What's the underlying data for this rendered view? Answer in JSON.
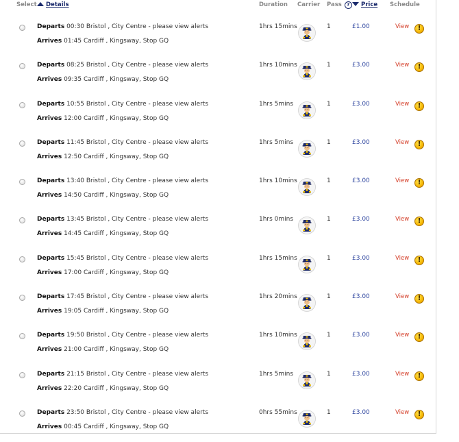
{
  "header": {
    "select": "Select",
    "details": "Details",
    "duration": "Duration",
    "carrier": "Carrier",
    "pass": "Pass",
    "price": "Price",
    "schedule": "Schedule"
  },
  "labels": {
    "departs": "Departs",
    "arrives": "Arrives",
    "view": "View",
    "alert_glyph": "!",
    "help_glyph": "?"
  },
  "colors": {
    "link_blue": "#1a2a6c",
    "price_blue": "#3047a0",
    "view_red": "#d5402b",
    "alert_yellow": "#f5b400"
  },
  "icons": {
    "carrier": "bus-driver-icon",
    "alert": "warning-icon",
    "sort_details": "triangle-up-icon",
    "sort_price": "triangle-down-icon",
    "help": "question-circle-icon"
  },
  "journeys": [
    {
      "depart": "00:30 Bristol , City Centre - please view alerts",
      "arrive": "01:45 Cardiff , Kingsway, Stop GQ",
      "duration": "1hrs 15mins",
      "pass": "1",
      "price": "£1.00"
    },
    {
      "depart": "08:25 Bristol , City Centre - please view alerts",
      "arrive": "09:35 Cardiff , Kingsway, Stop GQ",
      "duration": "1hrs 10mins",
      "pass": "1",
      "price": "£3.00"
    },
    {
      "depart": "10:55 Bristol , City Centre - please view alerts",
      "arrive": "12:00 Cardiff , Kingsway, Stop GQ",
      "duration": "1hrs 5mins",
      "pass": "1",
      "price": "£3.00"
    },
    {
      "depart": "11:45 Bristol , City Centre - please view alerts",
      "arrive": "12:50 Cardiff , Kingsway, Stop GQ",
      "duration": "1hrs 5mins",
      "pass": "1",
      "price": "£3.00"
    },
    {
      "depart": "13:40 Bristol , City Centre - please view alerts",
      "arrive": "14:50 Cardiff , Kingsway, Stop GQ",
      "duration": "1hrs 10mins",
      "pass": "1",
      "price": "£3.00"
    },
    {
      "depart": "13:45 Bristol , City Centre - please view alerts",
      "arrive": "14:45 Cardiff , Kingsway, Stop GQ",
      "duration": "1hrs 0mins",
      "pass": "1",
      "price": "£3.00"
    },
    {
      "depart": "15:45 Bristol , City Centre - please view alerts",
      "arrive": "17:00 Cardiff , Kingsway, Stop GQ",
      "duration": "1hrs 15mins",
      "pass": "1",
      "price": "£3.00"
    },
    {
      "depart": "17:45 Bristol , City Centre - please view alerts",
      "arrive": "19:05 Cardiff , Kingsway, Stop GQ",
      "duration": "1hrs 20mins",
      "pass": "1",
      "price": "£3.00"
    },
    {
      "depart": "19:50 Bristol , City Centre - please view alerts",
      "arrive": "21:00 Cardiff , Kingsway, Stop GQ",
      "duration": "1hrs 10mins",
      "pass": "1",
      "price": "£3.00"
    },
    {
      "depart": "21:15 Bristol , City Centre - please view alerts",
      "arrive": "22:20 Cardiff , Kingsway, Stop GQ",
      "duration": "1hrs 5mins",
      "pass": "1",
      "price": "£3.00"
    },
    {
      "depart": "23:50 Bristol , City Centre - please view alerts",
      "arrive": "00:45 Cardiff , Kingsway, Stop GQ",
      "duration": "0hrs 55mins",
      "pass": "1",
      "price": "£3.00"
    }
  ]
}
